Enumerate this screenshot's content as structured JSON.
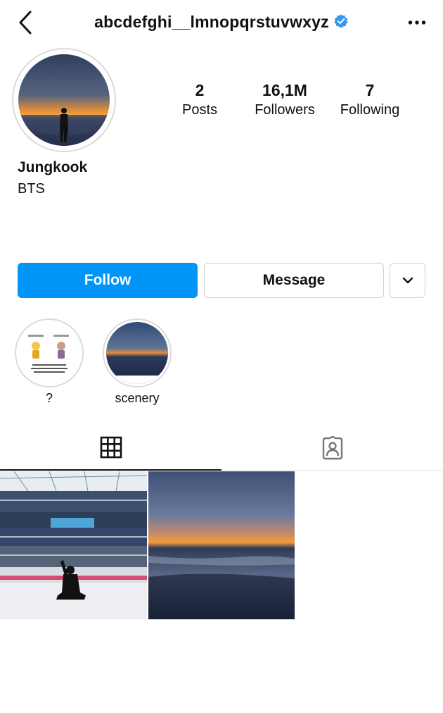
{
  "header": {
    "username": "abcdefghi__lmnopqrstuvwxyz",
    "back_icon": "chevron-left-icon",
    "verified_icon": "verified-badge-icon",
    "more_icon": "more-dots-icon"
  },
  "profile": {
    "display_name": "Jungkook",
    "bio": "BTS",
    "stats": [
      {
        "value": "2",
        "label": "Posts"
      },
      {
        "value": "16,1M",
        "label": "Followers"
      },
      {
        "value": "7",
        "label": "Following"
      }
    ]
  },
  "actions": {
    "follow_label": "Follow",
    "message_label": "Message",
    "dropdown_icon": "chevron-down-icon"
  },
  "highlights": [
    {
      "label": "?"
    },
    {
      "label": "scenery"
    }
  ],
  "tabs": [
    {
      "name": "posts-grid",
      "icon": "grid-icon",
      "selected": true
    },
    {
      "name": "tagged",
      "icon": "tagged-user-icon",
      "selected": false
    }
  ],
  "posts": [
    {
      "description_icon": "stadium-photo"
    },
    {
      "description_icon": "sunset-beach-photo"
    }
  ],
  "colors": {
    "follow_blue": "#0095f6",
    "verified_blue": "#3897f0",
    "border_gray": "#dbdbdb"
  }
}
